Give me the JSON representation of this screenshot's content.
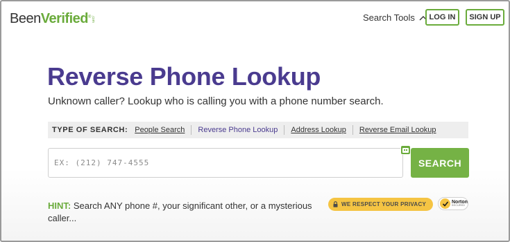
{
  "header": {
    "logo": {
      "part1": "Been",
      "part2": "Verified",
      "suffix": ".com",
      "mark": "®"
    },
    "search_tools_label": "Search Tools",
    "login_label": "LOG IN",
    "signup_label": "SIGN UP"
  },
  "main": {
    "title": "Reverse Phone Lookup",
    "subtitle": "Unknown caller? Lookup who is calling you with a phone number search.",
    "search_type": {
      "label": "TYPE OF SEARCH:",
      "options": [
        {
          "label": "People Search",
          "active": false
        },
        {
          "label": "Reverse Phone Lookup",
          "active": true
        },
        {
          "label": "Address Lookup",
          "active": false
        },
        {
          "label": "Reverse Email Lookup",
          "active": false
        }
      ]
    },
    "phone_input": {
      "placeholder": "EX: (212) 747-4555",
      "value": ""
    },
    "search_button_label": "SEARCH",
    "hint": {
      "label": "HINT:",
      "text": " Search ANY phone #, your significant other, or a mysterious caller..."
    },
    "privacy_badge": "WE RESPECT YOUR PRIVACY",
    "norton_badge": {
      "line1": "Norton",
      "line2": "SECURED"
    }
  },
  "colors": {
    "brand_purple": "#4a3b8f",
    "brand_green": "#6aab3b",
    "search_button": "#75b245",
    "privacy_yellow": "#f5c443"
  },
  "icons": {
    "search_tools_toggle": "chevron-up-icon",
    "input_addon": "contact-card-icon",
    "privacy": "lock-icon",
    "norton": "checkmark-icon"
  }
}
